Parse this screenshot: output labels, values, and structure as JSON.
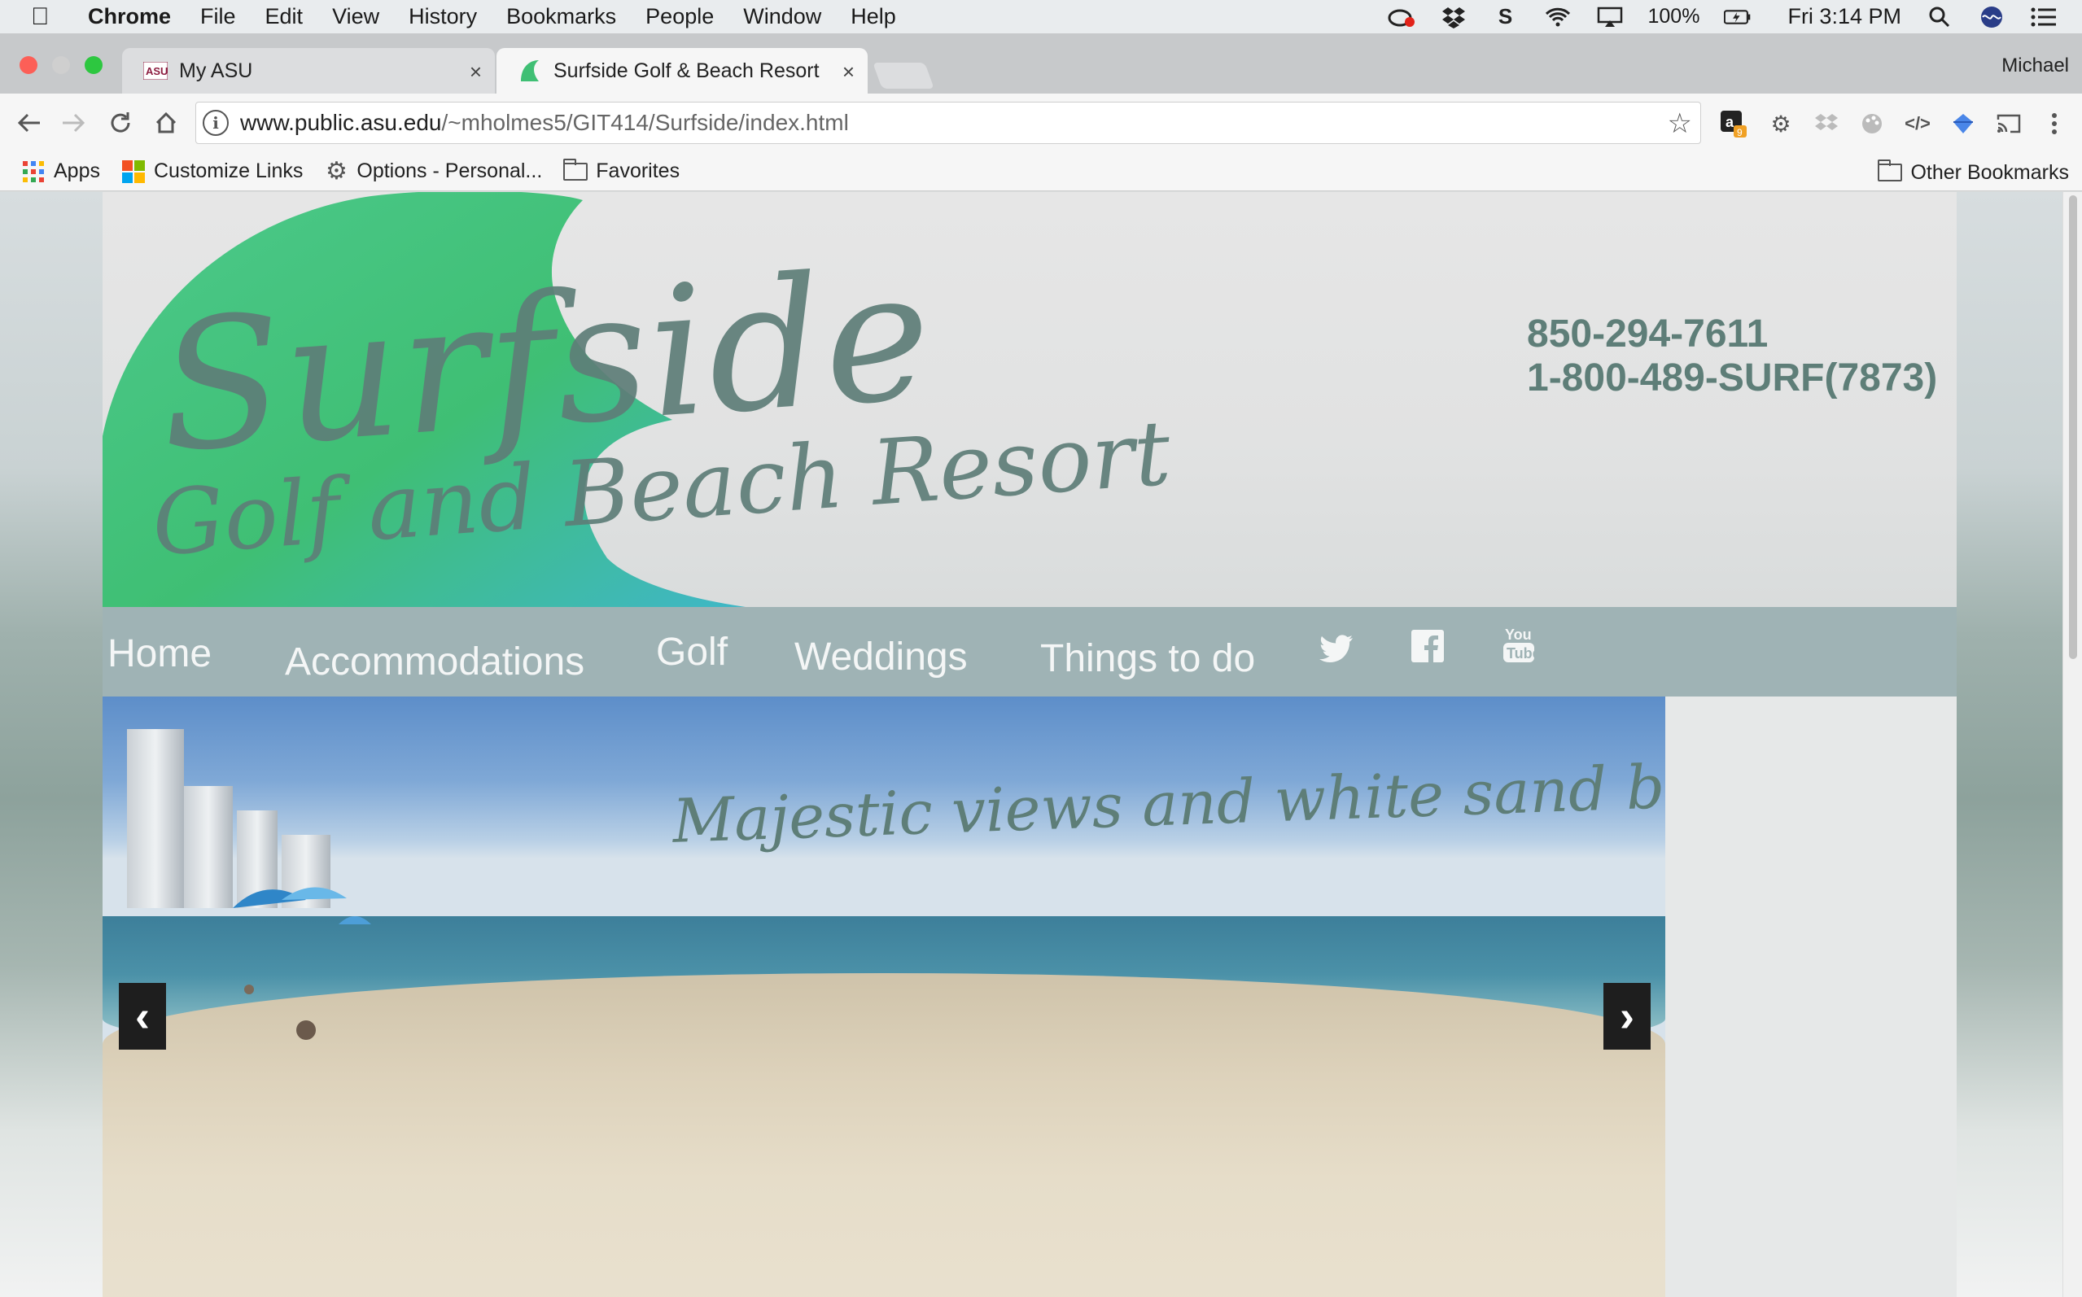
{
  "menubar": {
    "app_name": "Chrome",
    "items": [
      "File",
      "Edit",
      "View",
      "History",
      "Bookmarks",
      "People",
      "Window",
      "Help"
    ],
    "battery": "100%",
    "clock": "Fri 3:14 PM"
  },
  "tabs": [
    {
      "title": "My ASU",
      "active": false
    },
    {
      "title": "Surfside Golf & Beach Resort",
      "active": true
    }
  ],
  "profile_name": "Michael",
  "address_bar": {
    "url_host": "www.public.asu.edu",
    "url_path": "/~mholmes5/GIT414/Surfside/index.html"
  },
  "bookmarks": {
    "apps": "Apps",
    "customize": "Customize Links",
    "options": "Options - Personal...",
    "favorites": "Favorites",
    "other": "Other Bookmarks"
  },
  "site": {
    "logo_main": "Surfside",
    "logo_sub": "Golf and Beach Resort",
    "phone_local": "850-294-7611",
    "phone_tollfree": "1-800-489-SURF(7873)",
    "nav": [
      "Home",
      "Accommodations",
      "Golf",
      "Weddings",
      "Things to do"
    ],
    "social_icons": [
      "twitter-icon",
      "facebook-icon",
      "youtube-icon"
    ],
    "carousel_caption": "Majestic views and white sand beaches",
    "prev_arrow": "‹",
    "next_arrow": "›"
  },
  "colors": {
    "brand_text": "#5e7e78",
    "nav_bg": "#9fb3b5",
    "wave_green": "#3fbf74",
    "wave_teal": "#3fb7c7"
  }
}
